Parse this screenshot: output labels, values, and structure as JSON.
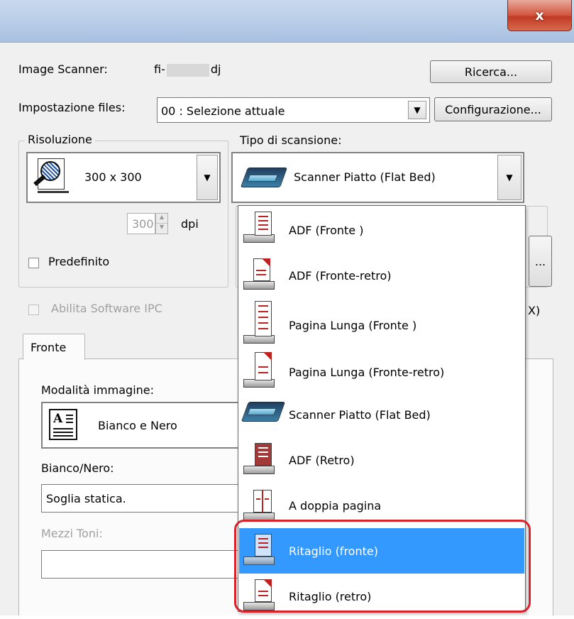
{
  "window": {
    "close_glyph": "x"
  },
  "scanner": {
    "label": "Image Scanner:",
    "value_prefix": "fi-",
    "value_suffix": "dj",
    "search_button": "Ricerca..."
  },
  "files": {
    "label": "Impostazione files:",
    "value": "00 : Selezione attuale",
    "config_button": "Configurazione..."
  },
  "resolution": {
    "group_label": "Risoluzione",
    "value": "300 x 300",
    "spin_value": "300",
    "unit": "dpi",
    "default_label": "Predefinito",
    "default_checked": false
  },
  "scan_type": {
    "label": "Tipo di scansione:",
    "value": "Scanner Piatto (Flat Bed)",
    "options": [
      {
        "label": "ADF (Fronte )",
        "icon": "adf-front-icon"
      },
      {
        "label": "ADF (Fronte-retro)",
        "icon": "adf-duplex-icon"
      },
      {
        "label": "Pagina Lunga (Fronte )",
        "icon": "long-page-front-icon"
      },
      {
        "label": "Pagina Lunga (Fronte-retro)",
        "icon": "long-page-duplex-icon"
      },
      {
        "label": "Scanner Piatto (Flat Bed)",
        "icon": "flatbed-scanner-icon"
      },
      {
        "label": "ADF (Retro)",
        "icon": "adf-back-icon"
      },
      {
        "label": "A doppia pagina",
        "icon": "double-page-icon"
      },
      {
        "label": "Ritaglio (fronte)",
        "icon": "crop-front-icon",
        "selected": true
      },
      {
        "label": "Ritaglio (retro)",
        "icon": "crop-back-icon"
      }
    ]
  },
  "ipc": {
    "label": "Abilita Software IPC",
    "checked": false,
    "partial_right_text": "X)"
  },
  "more_button": "...",
  "tabs": [
    {
      "label": "Fronte",
      "active": true
    }
  ],
  "image_mode": {
    "label": "Modalità immagine:",
    "value": "Bianco e Nero"
  },
  "bw": {
    "label": "Bianco/Nero:",
    "value": "Soglia statica."
  },
  "halftone": {
    "label": "Mezzi Toni:",
    "value": ""
  },
  "colors": {
    "selection": "#3399ff",
    "highlight_ring": "#d9222a",
    "close_button": "#c8452d"
  }
}
